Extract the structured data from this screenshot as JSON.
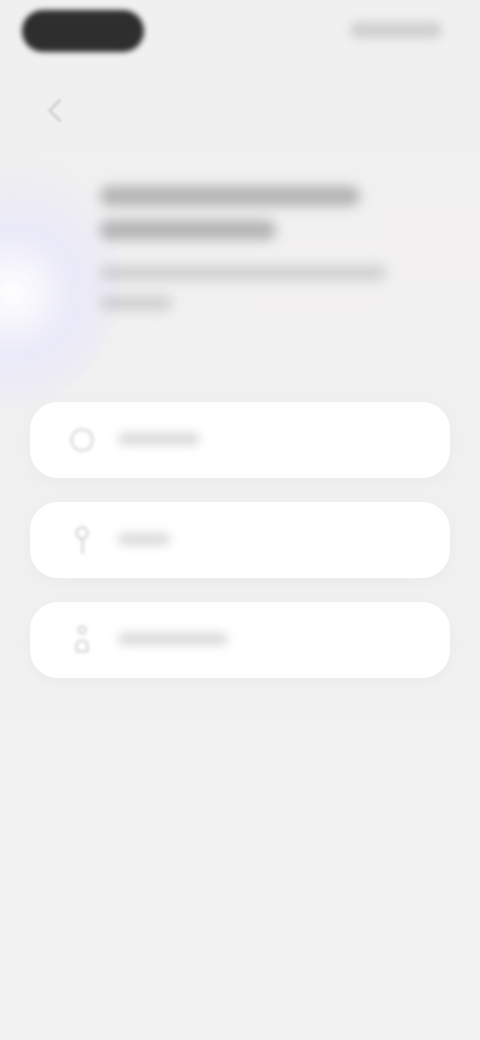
{
  "header": {
    "title": "",
    "subtitle": ""
  },
  "options": [
    {
      "label": ""
    },
    {
      "label": ""
    },
    {
      "label": ""
    }
  ],
  "icons": {
    "back": "back-icon",
    "option_1": "circle-icon",
    "option_2": "pin-icon",
    "option_3": "person-icon"
  },
  "colors": {
    "background": "#f2f0f0",
    "card": "#ffffff",
    "status_pill": "#232323"
  }
}
